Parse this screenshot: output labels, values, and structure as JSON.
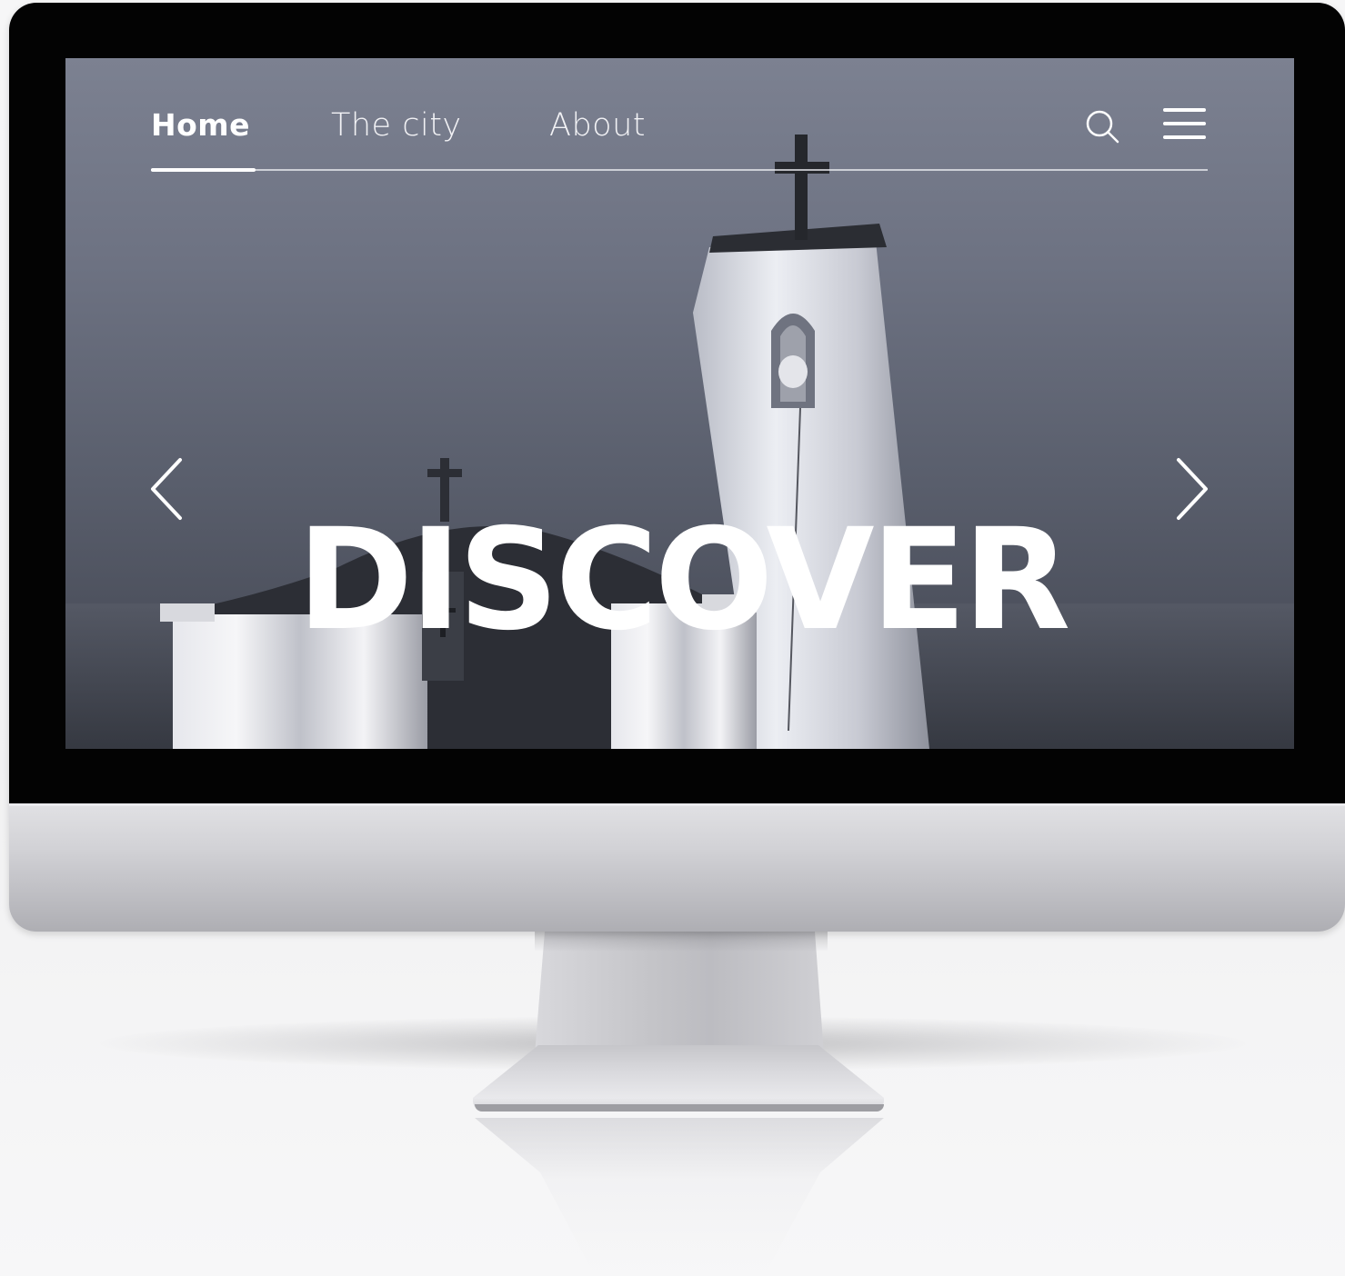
{
  "nav": {
    "items": [
      {
        "label": "Home",
        "active": true
      },
      {
        "label": "The city",
        "active": false
      },
      {
        "label": "About",
        "active": false
      }
    ],
    "icons": {
      "search": "search-icon",
      "menu": "hamburger-menu-icon"
    }
  },
  "hero": {
    "title": "DISCOVER",
    "prev_icon": "chevron-left-icon",
    "next_icon": "chevron-right-icon"
  },
  "colors": {
    "bezel": "#030303",
    "nav_text": "#ffffff",
    "sky": "#6d7282"
  }
}
